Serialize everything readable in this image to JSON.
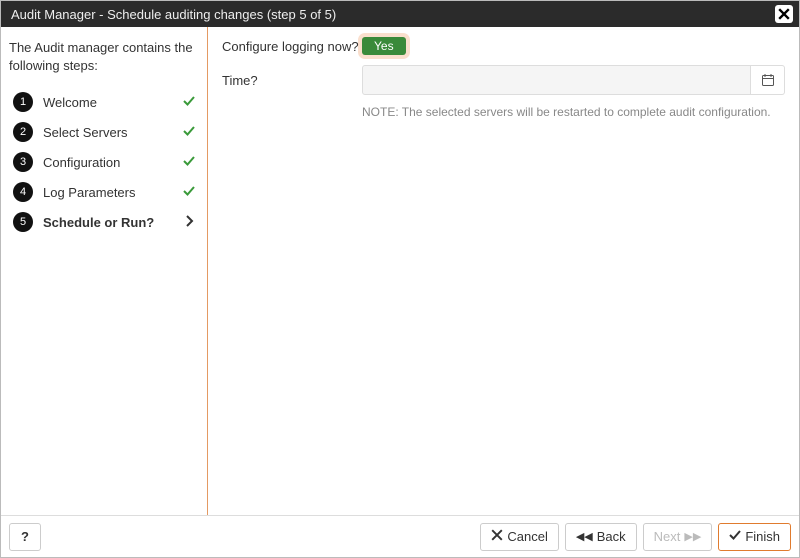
{
  "titlebar": {
    "text": "Audit Manager - Schedule auditing changes (step 5 of 5)"
  },
  "sidebar": {
    "intro": "The Audit manager contains the following steps:",
    "steps": [
      {
        "num": "1",
        "label": "Welcome",
        "done": true,
        "active": false
      },
      {
        "num": "2",
        "label": "Select Servers",
        "done": true,
        "active": false
      },
      {
        "num": "3",
        "label": "Configuration",
        "done": true,
        "active": false
      },
      {
        "num": "4",
        "label": "Log Parameters",
        "done": true,
        "active": false
      },
      {
        "num": "5",
        "label": "Schedule or Run?",
        "done": false,
        "active": true
      }
    ]
  },
  "form": {
    "configure_label": "Configure logging now?",
    "configure_value": "Yes",
    "time_label": "Time?",
    "time_value": "",
    "note": "NOTE: The selected servers will be restarted to complete audit configuration."
  },
  "footer": {
    "help": "?",
    "cancel": "Cancel",
    "back": "Back",
    "next": "Next",
    "finish": "Finish"
  }
}
